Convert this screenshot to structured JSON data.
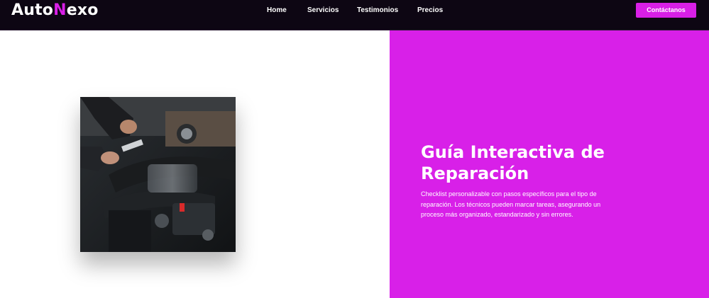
{
  "navbar": {
    "logo_prefix": "Auto",
    "logo_accent": "N",
    "logo_suffix": "exo",
    "links": [
      {
        "label": "Home"
      },
      {
        "label": "Servicios"
      },
      {
        "label": "Testimonios"
      },
      {
        "label": "Precios"
      }
    ],
    "cta_label": "Contáctanos"
  },
  "feature": {
    "title": "Guía Interactiva de Reparación",
    "description": "Checklist personalizable con pasos específicos para el tipo de reparación. Los técnicos pueden marcar tareas, asegurando un proceso más organizado, estandarizado y sin errores.",
    "image_subject": "mechanic-working-on-car-engine"
  },
  "colors": {
    "accent": "#d81fe6",
    "nav_background": "#0d0613",
    "panel_background": "#d820e8",
    "text_light": "#ffffff"
  }
}
